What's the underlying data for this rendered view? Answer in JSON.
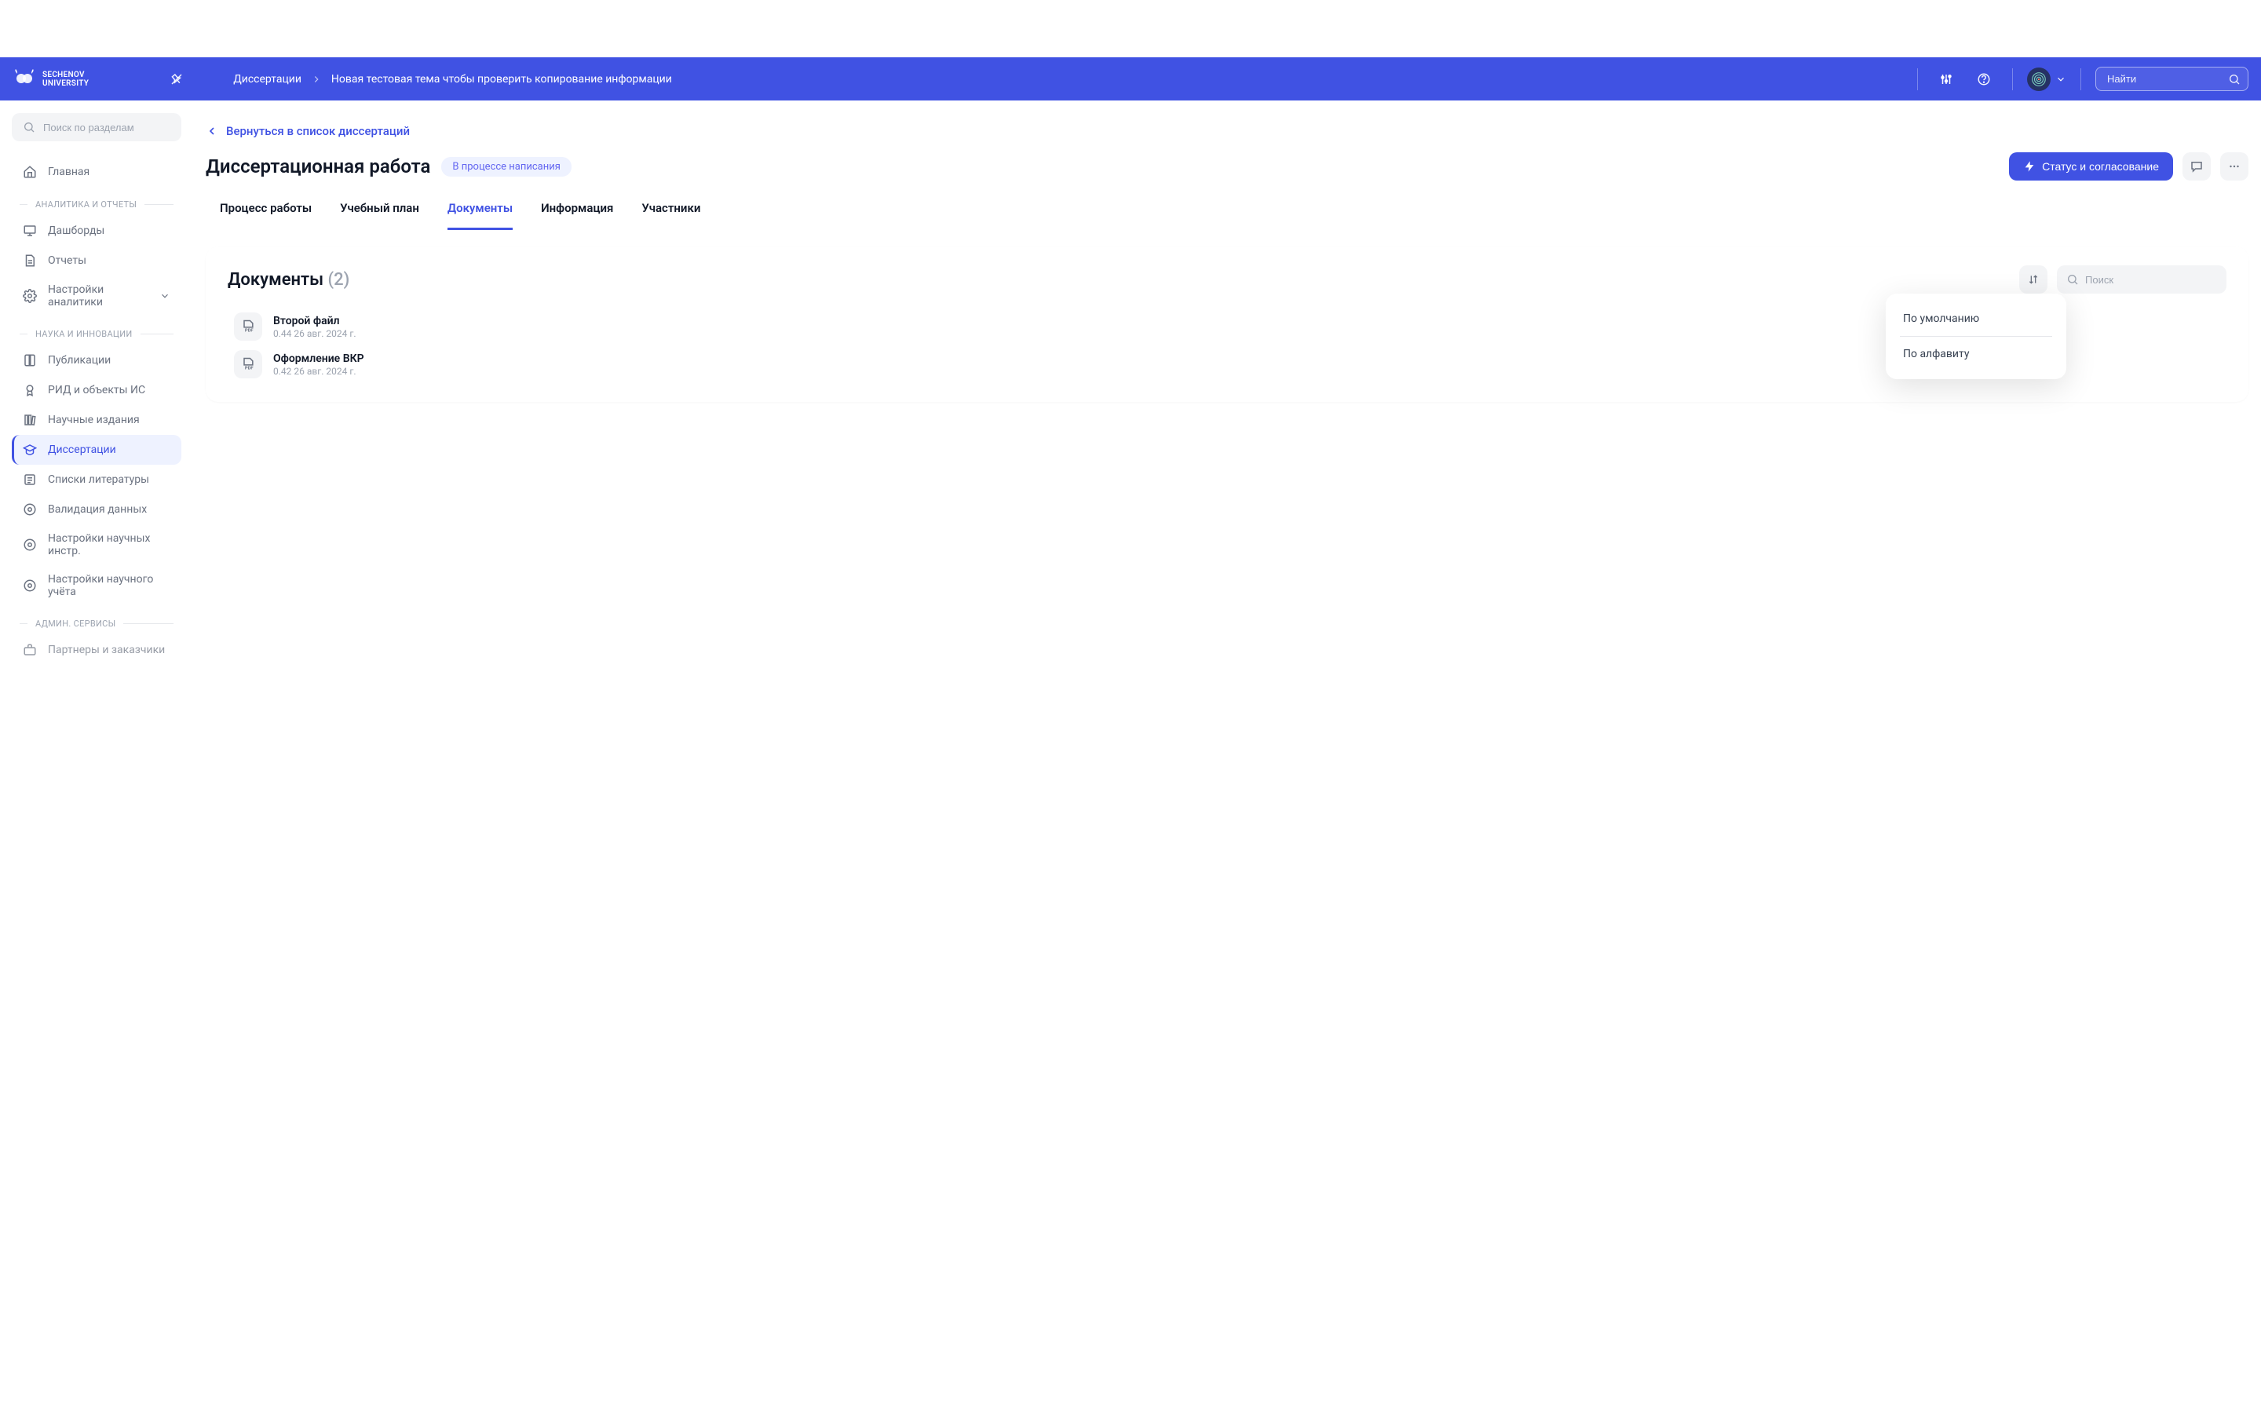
{
  "header": {
    "logo_top": "SECHENOV",
    "logo_bottom": "UNIVERSITY",
    "breadcrumb_1": "Диссертации",
    "breadcrumb_2": "Новая тестовая тема чтобы проверить копирование информации",
    "search_placeholder": "Найти"
  },
  "sidebar": {
    "search_placeholder": "Поиск по разделам",
    "home": "Главная",
    "section_1": "АНАЛИТИКА И ОТЧЕТЫ",
    "dashboards": "Дашборды",
    "reports": "Отчеты",
    "analytics_settings": "Настройки аналитики",
    "section_2": "НАУКА И ИННОВАЦИИ",
    "publications": "Публикации",
    "rid": "РИД и объекты ИС",
    "editions": "Научные издания",
    "dissertations": "Диссертации",
    "lit_lists": "Списки литературы",
    "validation": "Валидация данных",
    "sci_tools": "Настройки научных инстр.",
    "sci_account": "Настройки научного учёта",
    "section_3": "АДМИН. СЕРВИСЫ",
    "partners": "Партнеры и заказчики"
  },
  "page": {
    "back_label": "Вернуться в список диссертаций",
    "title": "Диссертационная работа",
    "status_badge": "В процессе написания",
    "status_button": "Статус и согласование"
  },
  "tabs": {
    "t1": "Процесс работы",
    "t2": "Учебный план",
    "t3": "Документы",
    "t4": "Информация",
    "t5": "Участники"
  },
  "documents": {
    "title": "Документы",
    "count": "(2)",
    "search_placeholder": "Поиск",
    "items": [
      {
        "name": "Второй файл",
        "meta": "0.44 26 авг. 2024 г."
      },
      {
        "name": "Оформление ВКР",
        "meta": "0.42 26 авг. 2024 г."
      }
    ]
  },
  "sort_dropdown": {
    "opt1": "По умолчанию",
    "opt2": "По алфавиту"
  }
}
